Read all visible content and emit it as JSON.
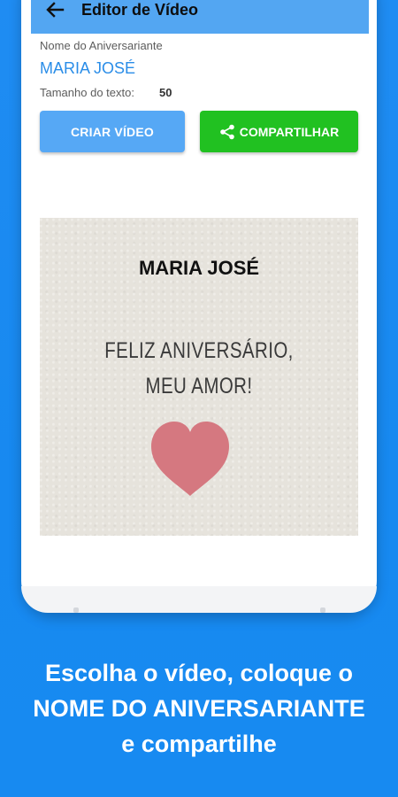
{
  "appbar": {
    "title": "Editor de Vídeo",
    "back_icon": "arrow-left-icon"
  },
  "form": {
    "name_label": "Nome do Aniversariante",
    "name_value": "MARIA JOSÉ",
    "size_label": "Tamanho do texto:",
    "size_value": "50"
  },
  "buttons": {
    "create_label": "CRIAR VÍDEO",
    "share_label": "COMPARTILHAR",
    "share_icon": "share-icon"
  },
  "preview": {
    "name": "MARIA JOSÉ",
    "message_line1": "FELIZ ANIVERSÁRIO,",
    "message_line2": "MEU AMOR!",
    "heart_color": "#d57880"
  },
  "caption": {
    "line1": "Escolha o vídeo, coloque o",
    "line2": "NOME DO ANIVERSARIANTE",
    "line3": "e compartilhe"
  },
  "colors": {
    "background": "#1b8ef3",
    "appbar": "#53a6f2",
    "create_button": "#56a8f5",
    "share_button": "#21c121",
    "accent_text": "#2a8de8"
  }
}
